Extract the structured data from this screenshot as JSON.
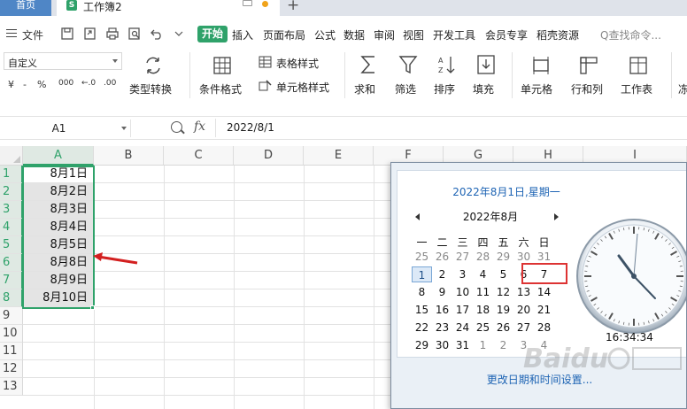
{
  "tabs": {
    "home": "首页",
    "doc_icon": "S",
    "doc_name": "工作簿2",
    "add": "+"
  },
  "menu": {
    "file": "文件",
    "active": "开始",
    "items": [
      "插入",
      "页面布局",
      "公式",
      "数据",
      "审阅",
      "视图",
      "开发工具",
      "会员专享",
      "稻壳资源"
    ],
    "search": "Q查找命令..."
  },
  "ribbon": {
    "number_format": "自定义",
    "number_buttons": [
      "¥",
      "-",
      "%",
      "000",
      "←.0",
      ".00"
    ],
    "type_convert": "类型转换",
    "conditional_format": "条件格式",
    "table_style": "表格样式",
    "cell_style": "单元格样式",
    "sum": "求和",
    "filter": "筛选",
    "sort": "排序",
    "fill": "填充",
    "cell": "单元格",
    "row_col": "行和列",
    "worksheet": "工作表",
    "freeze": "冻"
  },
  "formula_bar": {
    "name_box": "A1",
    "fx": "fx",
    "value": "2022/8/1"
  },
  "grid": {
    "columns": [
      "A",
      "B",
      "C",
      "D",
      "E",
      "F",
      "G",
      "H",
      "I"
    ],
    "rows": [
      "1",
      "2",
      "3",
      "4",
      "5",
      "6",
      "7",
      "8",
      "9",
      "10",
      "11",
      "12",
      "13"
    ],
    "cells_a": [
      "8月1日",
      "8月2日",
      "8月3日",
      "8月4日",
      "8月5日",
      "8月8日",
      "8月9日",
      "8月10日"
    ],
    "accent": "#2fa26a"
  },
  "clock_popup": {
    "long_date": "2022年8月1日,星期一",
    "month": "2022年8月",
    "weekdays": [
      "一",
      "二",
      "三",
      "四",
      "五",
      "六",
      "日"
    ],
    "weeks": [
      [
        "25",
        "26",
        "27",
        "28",
        "29",
        "30",
        "31"
      ],
      [
        "1",
        "2",
        "3",
        "4",
        "5",
        "6",
        "7"
      ],
      [
        "8",
        "9",
        "10",
        "11",
        "12",
        "13",
        "14"
      ],
      [
        "15",
        "16",
        "17",
        "18",
        "19",
        "20",
        "21"
      ],
      [
        "22",
        "23",
        "24",
        "25",
        "26",
        "27",
        "28"
      ],
      [
        "29",
        "30",
        "31",
        "1",
        "2",
        "3",
        "4"
      ]
    ],
    "time": "16:34:34",
    "change_link": "更改日期和时间设置...",
    "highlight_color": "#dd3333"
  },
  "watermark": "Baidu 经验"
}
